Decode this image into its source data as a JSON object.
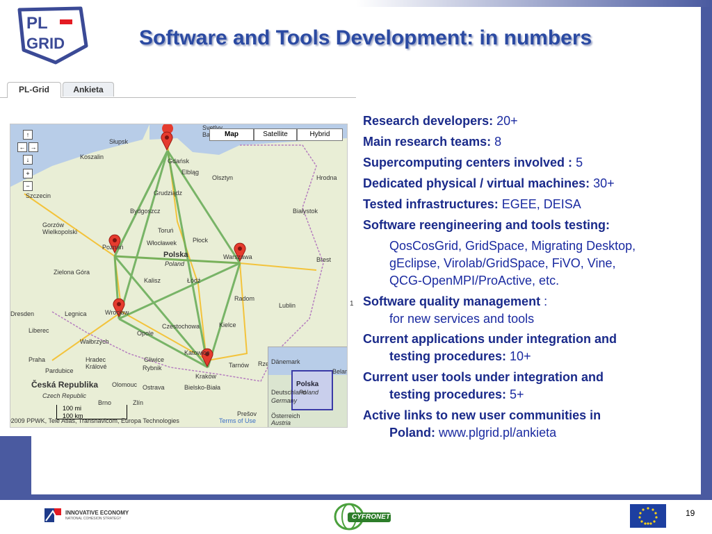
{
  "title": "Software and Tools Development: in numbers",
  "logo": {
    "line1": "PL",
    "line2": "GRID"
  },
  "tabs": [
    {
      "label": "PL-Grid",
      "active": true
    },
    {
      "label": "Ankieta",
      "active": false
    }
  ],
  "map": {
    "maptypes": [
      {
        "label": "Map",
        "selected": true
      },
      {
        "label": "Satellite",
        "selected": false
      },
      {
        "label": "Hybrid",
        "selected": false
      }
    ],
    "country_label": "Polska",
    "country_sub": "Poland",
    "cities": [
      "Gdańsk",
      "Słupsk",
      "Koszalin",
      "Elbląg",
      "Olsztyn",
      "Szczecin",
      "Grudziądz",
      "Bydgoszcz",
      "Białystok",
      "Hrodna",
      "Gorzów Wielkopolski",
      "Toruń",
      "Poznań",
      "Włocławek",
      "Płock",
      "Warszawa",
      "Zielona Góra",
      "Kalisz",
      "Łódź",
      "Brest",
      "Radom",
      "Legnica",
      "Wrocław",
      "Lublin",
      "Czestochowa",
      "Kielce",
      "Liberec",
      "Opole",
      "Wałbrzych",
      "Praha",
      "Hradec Králové",
      "Gliwice",
      "Katowice",
      "Tarnów",
      "Pardubice",
      "Rybnik",
      "Kraków",
      "Česká Republika",
      "Olomouc",
      "Ostrava",
      "Bielsko-Biała",
      "Czech Republic",
      "Brno",
      "Zlín",
      "Prešov",
      "Dresden",
      "Svetlyy",
      "Baltiysk",
      "Rzeszów",
      "Dänemark",
      "Deutschland",
      "Germany",
      "Österreich",
      "Austria",
      "Belarus"
    ],
    "scale_label": "100 mi",
    "scale_km": "100 km",
    "copyright": "©2009 PPWK, Tele Atlas, Transnavicom, Europa Technologies",
    "terms": "Terms of Use",
    "inset_label": "Polska",
    "inset_sub": "Poland",
    "markers": [
      "Gdańsk",
      "Poznań",
      "Warszawa",
      "Wrocław",
      "Kraków"
    ]
  },
  "items": [
    {
      "label": "Research developers:",
      "value": "20+"
    },
    {
      "label": "Main research teams:",
      "value": "8"
    },
    {
      "label": "Supercomputing centers involved :",
      "value": "5"
    },
    {
      "label": "Dedicated physical  / virtual machines:",
      "value": "30+"
    },
    {
      "label": "Tested infrastructures:",
      "value": "EGEE, DEISA"
    },
    {
      "label": "Software reengineering and tools testing:",
      "value": ""
    }
  ],
  "reeng_lines": [
    "QosCosGrid, GridSpace, Migrating Desktop,",
    "gEclipse, Virolab/GridSpace, FiVO, Vine,",
    "QCG-OpenMPI/ProActive, etc."
  ],
  "quality": {
    "label": "Software quality management",
    "colon": " :",
    "sub": "for new services and tools"
  },
  "apps": {
    "line1": "Current applications under integration and",
    "line2": "testing procedures:",
    "value": "10+"
  },
  "tools": {
    "line1": "Current user tools under integration and",
    "line2": "testing procedures:",
    "value": "5+"
  },
  "links": {
    "line1": "Active links to new user communities in",
    "line2": "Poland:",
    "value": "www.plgrid.pl/ankieta"
  },
  "sidenote": "1",
  "footer": {
    "innovative": "INNOVATIVE ECONOMY",
    "innovative_sub": "NATIONAL COHESION STRATEGY",
    "cyfronet": "CYFRONET",
    "page": "19"
  },
  "colors": {
    "accent": "#4a5aa0",
    "title": "#2b4aa2",
    "text": "#1a2a8a"
  }
}
